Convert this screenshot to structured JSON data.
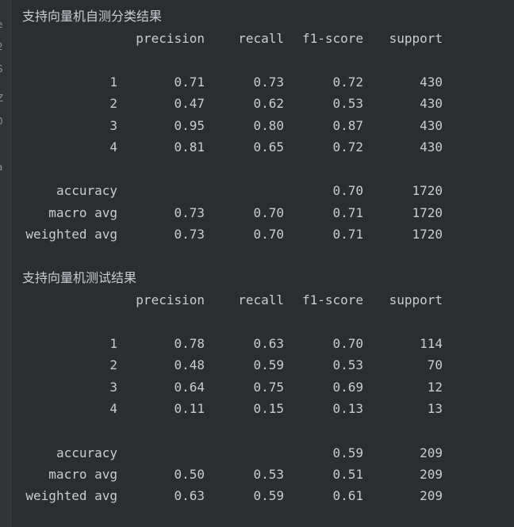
{
  "gutter_chars": [
    "e",
    "2",
    "S",
    "Z",
    "0",
    "(",
    "a"
  ],
  "reports": [
    {
      "title": "支持向量机自测分类结果",
      "headers": [
        "precision",
        "recall",
        "f1-score",
        "support"
      ],
      "class_rows": [
        {
          "label": "1",
          "precision": "0.71",
          "recall": "0.73",
          "f1": "0.72",
          "support": "430"
        },
        {
          "label": "2",
          "precision": "0.47",
          "recall": "0.62",
          "f1": "0.53",
          "support": "430"
        },
        {
          "label": "3",
          "precision": "0.95",
          "recall": "0.80",
          "f1": "0.87",
          "support": "430"
        },
        {
          "label": "4",
          "precision": "0.81",
          "recall": "0.65",
          "f1": "0.72",
          "support": "430"
        }
      ],
      "summary_rows": [
        {
          "label": "accuracy",
          "precision": "",
          "recall": "",
          "f1": "0.70",
          "support": "1720"
        },
        {
          "label": "macro avg",
          "precision": "0.73",
          "recall": "0.70",
          "f1": "0.71",
          "support": "1720"
        },
        {
          "label": "weighted avg",
          "precision": "0.73",
          "recall": "0.70",
          "f1": "0.71",
          "support": "1720"
        }
      ]
    },
    {
      "title": "支持向量机测试结果",
      "headers": [
        "precision",
        "recall",
        "f1-score",
        "support"
      ],
      "class_rows": [
        {
          "label": "1",
          "precision": "0.78",
          "recall": "0.63",
          "f1": "0.70",
          "support": "114"
        },
        {
          "label": "2",
          "precision": "0.48",
          "recall": "0.59",
          "f1": "0.53",
          "support": "70"
        },
        {
          "label": "3",
          "precision": "0.64",
          "recall": "0.75",
          "f1": "0.69",
          "support": "12"
        },
        {
          "label": "4",
          "precision": "0.11",
          "recall": "0.15",
          "f1": "0.13",
          "support": "13"
        }
      ],
      "summary_rows": [
        {
          "label": "accuracy",
          "precision": "",
          "recall": "",
          "f1": "0.59",
          "support": "209"
        },
        {
          "label": "macro avg",
          "precision": "0.50",
          "recall": "0.53",
          "f1": "0.51",
          "support": "209"
        },
        {
          "label": "weighted avg",
          "precision": "0.63",
          "recall": "0.59",
          "f1": "0.61",
          "support": "209"
        }
      ]
    }
  ]
}
